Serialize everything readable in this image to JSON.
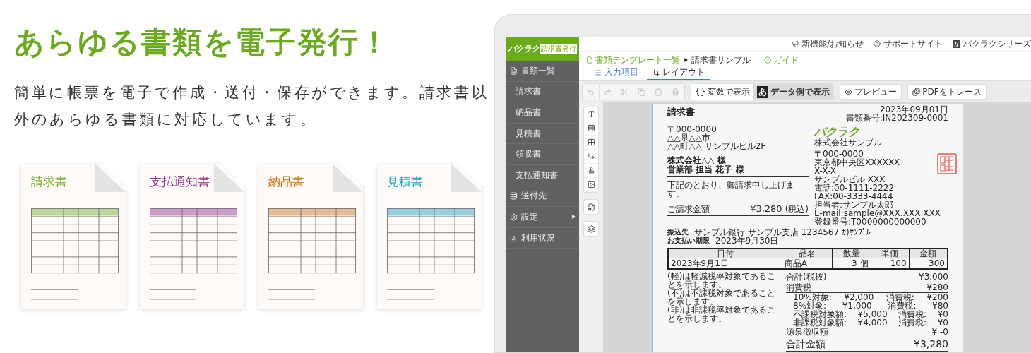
{
  "headline": "あらゆる書類を電子発行！",
  "lead": "簡単に帳票を電子で作成・送付・保存ができます。請求書以外のあらゆる書類に対応しています。",
  "doc_cards": [
    {
      "title": "請求書",
      "color": "#6aab1e"
    },
    {
      "title": "支払通知書",
      "color": "#8b2d8b"
    },
    {
      "title": "納品書",
      "color": "#c86f12"
    },
    {
      "title": "見積書",
      "color": "#1a9cc0"
    }
  ],
  "app": {
    "logo": "バクラク",
    "logo_badge": "請求書発行",
    "header_links": [
      "新機能/お知らせ",
      "サポートサイト",
      "バクラクシリーズ"
    ],
    "sidebar": [
      {
        "label": "書類一覧",
        "kind": "section",
        "expandable": false
      },
      {
        "label": "請求書",
        "kind": "sub",
        "expandable": false
      },
      {
        "label": "納品書",
        "kind": "sub",
        "expandable": false
      },
      {
        "label": "見積書",
        "kind": "sub",
        "expandable": false
      },
      {
        "label": "領収書",
        "kind": "sub",
        "expandable": false
      },
      {
        "label": "支払通知書",
        "kind": "sub",
        "expandable": false
      },
      {
        "label": "送付先",
        "kind": "section",
        "expandable": false
      },
      {
        "label": "設定",
        "kind": "section",
        "expandable": true
      },
      {
        "label": "利用状況",
        "kind": "section",
        "expandable": false
      }
    ],
    "breadcrumb": [
      "書類テンプレート一覧",
      "請求書サンプル"
    ],
    "guide": "ガイド",
    "tabs": [
      {
        "label": "入力項目",
        "selected": false
      },
      {
        "label": "レイアウト",
        "selected": true
      }
    ],
    "view_toggle": [
      {
        "glyph": "{}",
        "label": "変数で表示",
        "selected": false
      },
      {
        "glyph": "あ",
        "label": "データ例で表示",
        "selected": true
      }
    ],
    "actions": [
      "プレビュー",
      "PDFをトレース"
    ]
  },
  "document": {
    "title": "請求書",
    "date": "2023年09月01日",
    "number": "書類番号:IN202309-0001",
    "client_address": [
      "〒000-0000",
      "△△県△△市",
      "△△町△△ サンプルビル2F"
    ],
    "client_names": [
      "株式会社△△ 様",
      "営業部 担当 花子 様"
    ],
    "greeting": "下記のとおり、御請求申し上げます。",
    "amount_label": "ご請求金額",
    "amount": "¥3,280",
    "amount_note": "(税込)",
    "issuer_logo": "バクラク",
    "issuer_name": "株式会社サンプル",
    "issuer_lines": [
      "〒000-0000",
      "東京都中央区XXXXXX",
      "X-X-X",
      "サンプルビル XXX",
      "電話:00-1111-2222",
      "FAX:00-3333-4444",
      "担当者:サンプル太郎",
      "E-mail:sample@XXX.XXX.XXX",
      "登録番号:T0000000000000"
    ],
    "bank_label": "振込先",
    "bank": "サンプル銀行 サンプル支店 1234567 ｶ)ｻﾝﾌﾟﾙ",
    "due_label": "お支払い期限",
    "due": "2023年9月30日",
    "table": {
      "columns": [
        "日付",
        "品名",
        "数量",
        "単価",
        "金額"
      ],
      "rows": [
        [
          "2023年9月1日",
          "商品A",
          "3 個",
          "100",
          "300"
        ]
      ]
    },
    "notes": [
      "(軽)は軽減税率対象であることを示します。",
      "(不)は不課税対象であることを示します。",
      "(非)は非課税率対象であることを示します。"
    ],
    "totals": [
      {
        "kind": "main",
        "label": "合計(税抜)",
        "value": "¥3,000"
      },
      {
        "kind": "main",
        "label": "消費税",
        "value": "¥280"
      },
      {
        "kind": "breakdown",
        "label": "10%対象:",
        "base": "¥2,000",
        "tax_label": "消費税:",
        "value": "¥200"
      },
      {
        "kind": "breakdown",
        "label": "8%対象:",
        "base": "¥1,000",
        "tax_label": "消費税:",
        "value": "¥80"
      },
      {
        "kind": "breakdown",
        "label": "不課税対象額:",
        "base": "¥5,000",
        "tax_label": "消費税:",
        "value": "¥0"
      },
      {
        "kind": "breakdown",
        "label": "非課税対象額:",
        "base": "¥4,000",
        "tax_label": "消費税:",
        "value": "¥0"
      },
      {
        "kind": "main",
        "label": "源泉徴収額",
        "value": "¥ -0"
      },
      {
        "kind": "grand",
        "label": "合計金額",
        "value": "¥3,280"
      }
    ]
  }
}
